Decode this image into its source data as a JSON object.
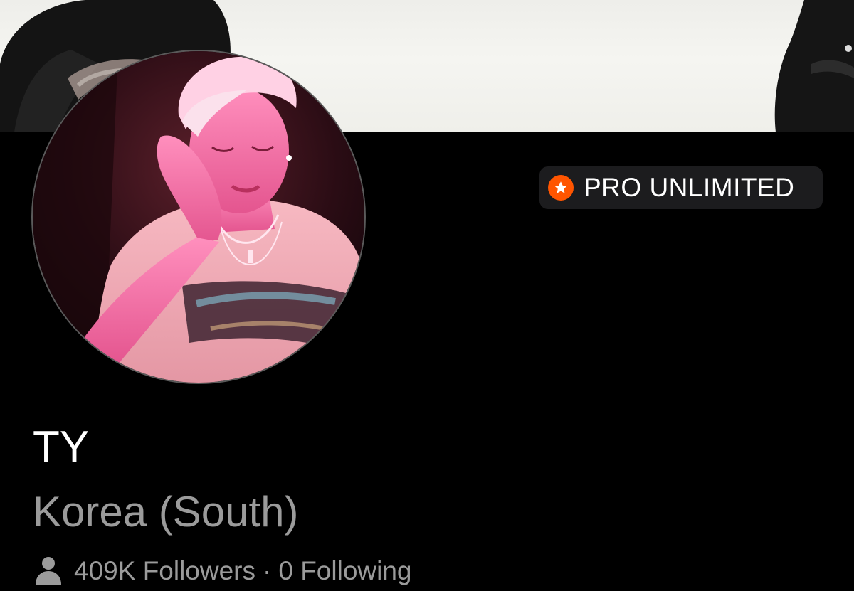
{
  "profile": {
    "username": "TY",
    "location": "Korea (South)",
    "followers_label": "409K Followers",
    "separator": "·",
    "following_label": "0 Following"
  },
  "badge": {
    "label": "PRO UNLIMITED",
    "icon": "star-icon",
    "icon_color": "#ff5500"
  },
  "icons": {
    "followers": "person-icon"
  },
  "colors": {
    "background": "#000000",
    "badge_background": "#1c1c1e",
    "secondary_text": "#9b9b9b"
  }
}
